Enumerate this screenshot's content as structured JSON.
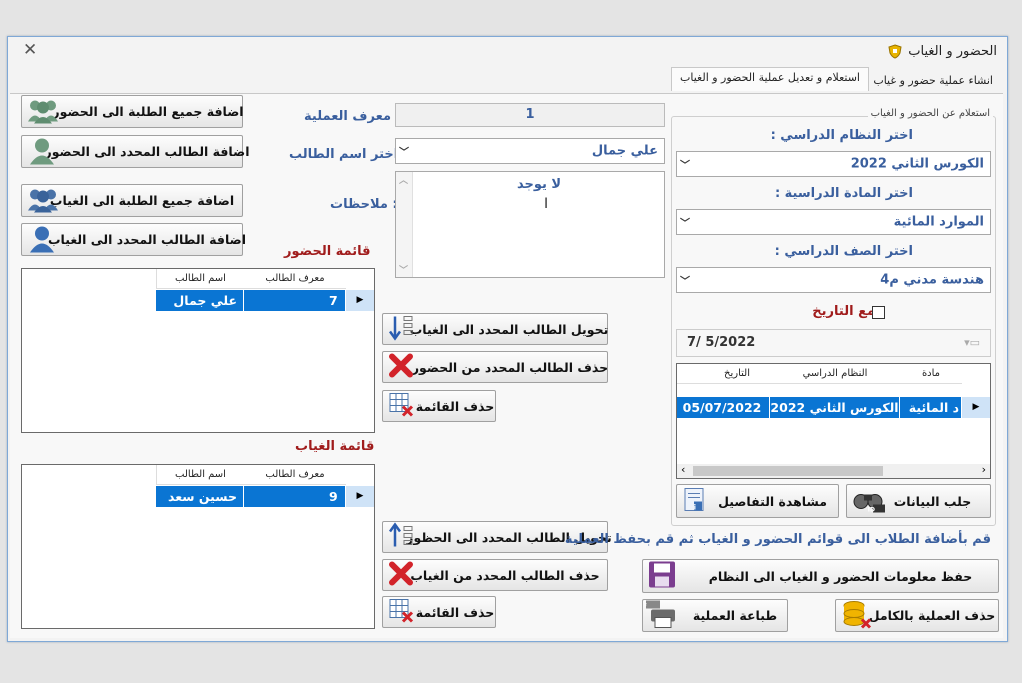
{
  "window": {
    "title": "الحضور و الغياب"
  },
  "tabs": [
    {
      "label": "انشاء عملية حضور و غياب"
    },
    {
      "label": "استعلام و تعديل عملية الحضور و الغياب"
    }
  ],
  "query_group": {
    "legend": "استعلام عن الحضور و الغياب",
    "system_label": "اختر النظام الدراسي :",
    "system_value": "الكورس الثاني 2022",
    "subject_label": "اختر المادة الدراسية :",
    "subject_value": "الموارد المائية",
    "class_label": "اختر الصف الدراسي :",
    "class_value": "هندسة مدني م4",
    "with_date_label": "مع التاريخ",
    "date_value": "7/  5/2022",
    "results_columns": [
      "مادة",
      "النظام الدراسي",
      "التاريخ"
    ],
    "results_rows": [
      {
        "subject": "د المائية",
        "system": "الكورس الثاني 2022",
        "date": "05/07/2022"
      }
    ],
    "fetch_button": "جلب البيانات",
    "details_button": "مشاهدة التفاصيل"
  },
  "operation": {
    "id_label": ": معرف العملية",
    "id_value": "1",
    "student_label": ": اختر اسم الطالب",
    "student_value": "علي جمال",
    "notes_label": ": ملاحظات",
    "notes_value": "لا يوجد"
  },
  "left_buttons": {
    "add_all_present": "اضافة جميع الطلبة الى الحضور",
    "add_selected_present": "اضافة الطالب المحدد الى الحضور",
    "add_all_absent": "اضافة جميع الطلبة الى الغياب",
    "add_selected_absent": "اضافة الطالب المحدد الى الغياب"
  },
  "attendance_list": {
    "title": "قائمة الحضور",
    "columns": [
      "معرف الطالب",
      "اسم الطالب"
    ],
    "rows": [
      {
        "id": "7",
        "name": "علي جمال"
      }
    ]
  },
  "absence_list": {
    "title": "قائمة الغياب",
    "columns": [
      "معرف الطالب",
      "اسم الطالب"
    ],
    "rows": [
      {
        "id": "9",
        "name": "حسين سعد"
      }
    ]
  },
  "middle_buttons": {
    "move_to_absent": "تحويل الطالب المحدد الى الغياب",
    "delete_from_present": "حذف الطالب المحدد من الحضور",
    "delete_present_list": "حذف القائمة",
    "move_to_present": "تحويل الطالب المحدد الى الحظور",
    "delete_from_absent": "حذف الطالب المحدد من الغياب",
    "delete_absent_list": "حذف القائمة"
  },
  "footer": {
    "hint": "قم بأضافة الطلاب الى قوائم الحضور و الغياب ثم قم بحفظ العملية",
    "save_button": "حفظ معلومات الحضور و الغياب الى النظام",
    "print_button": "طباعة العملية",
    "delete_op_button": "حذف العملية بالكامل"
  },
  "colors": {
    "accent_blue": "#3a5f9e",
    "label_red": "#a01c1c",
    "selection": "#0a75d3"
  }
}
